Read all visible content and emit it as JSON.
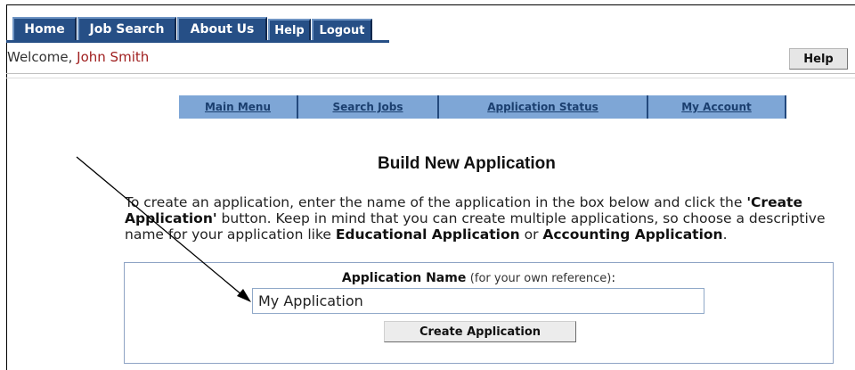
{
  "top_nav": {
    "tabs": [
      {
        "label": "Home"
      },
      {
        "label": "Job Search"
      },
      {
        "label": "About Us"
      },
      {
        "label": "Help"
      },
      {
        "label": "Logout"
      }
    ]
  },
  "header": {
    "welcome_prefix": "Welcome,",
    "user_name": "John Smith",
    "help_label": "Help"
  },
  "sub_nav": {
    "items": [
      {
        "label": "Main Menu"
      },
      {
        "label": "Search Jobs"
      },
      {
        "label": "Application Status"
      },
      {
        "label": "My Account"
      }
    ]
  },
  "main": {
    "title": "Build New Application",
    "instructions": {
      "part1": "To create an application, enter the name of the application in the box below and click the ",
      "quoted_button": "'Create Application'",
      "part2": " button. Keep in mind that you can create multiple applications, so choose a descriptive name for your application like ",
      "example1": "Educational Application",
      "part3": " or ",
      "example2": "Accounting Application",
      "part4": "."
    },
    "form": {
      "label_bold": "Application Name",
      "label_hint": "(for your own reference)",
      "label_colon": ":",
      "input_value": "My Application",
      "submit_label": "Create Application"
    }
  },
  "colors": {
    "nav_bg": "#264f86",
    "subnav_bg": "#7ea6d6",
    "user_name": "#a02020"
  },
  "annotations": {
    "arrow": "pointer-arrow"
  }
}
